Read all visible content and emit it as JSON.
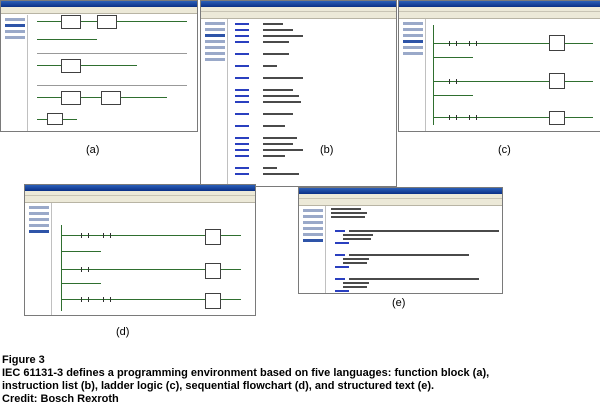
{
  "panels": [
    {
      "id": "a",
      "label": "(a)",
      "language": "function block"
    },
    {
      "id": "b",
      "label": "(b)",
      "language": "instruction list"
    },
    {
      "id": "c",
      "label": "(c)",
      "language": "ladder logic"
    },
    {
      "id": "d",
      "label": "(d)",
      "language": "sequential flowchart"
    },
    {
      "id": "e",
      "label": "(e)",
      "language": "structured text"
    }
  ],
  "caption": {
    "figure": "Figure 3",
    "line1": "IEC 61131-3 defines a programming environment based on five languages: function block (a),",
    "line2": "instruction list (b), ladder logic (c), sequential flowchart (d), and structured text (e).",
    "credit": "Credit: Bosch Rexroth"
  }
}
